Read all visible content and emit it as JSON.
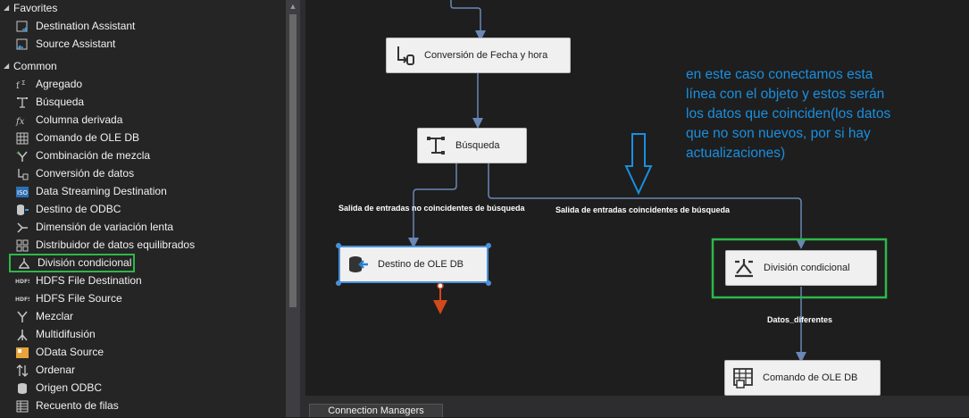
{
  "toolbox": {
    "favorites": {
      "label": "Favorites",
      "items": [
        {
          "label": "Destination Assistant",
          "icon": "destination-assistant-icon"
        },
        {
          "label": "Source Assistant",
          "icon": "source-assistant-icon"
        }
      ]
    },
    "common": {
      "label": "Common",
      "items": [
        {
          "label": "Agregado",
          "icon": "aggregate-icon"
        },
        {
          "label": "Búsqueda",
          "icon": "lookup-icon"
        },
        {
          "label": "Columna derivada",
          "icon": "derived-column-icon"
        },
        {
          "label": "Comando de OLE DB",
          "icon": "ole-db-command-icon"
        },
        {
          "label": "Combinación de mezcla",
          "icon": "merge-join-icon"
        },
        {
          "label": "Conversión de datos",
          "icon": "data-conversion-icon"
        },
        {
          "label": "Data Streaming Destination",
          "icon": "data-streaming-icon"
        },
        {
          "label": "Destino de ODBC",
          "icon": "odbc-destination-icon"
        },
        {
          "label": "Dimensión de variación lenta",
          "icon": "slowly-changing-dimension-icon"
        },
        {
          "label": "Distribuidor de datos equilibrados",
          "icon": "balanced-distributor-icon"
        },
        {
          "label": "División condicional",
          "icon": "conditional-split-icon",
          "selected": true
        },
        {
          "label": "HDFS File Destination",
          "icon": "hdfs-destination-icon"
        },
        {
          "label": "HDFS File Source",
          "icon": "hdfs-source-icon"
        },
        {
          "label": "Mezclar",
          "icon": "merge-icon"
        },
        {
          "label": "Multidifusión",
          "icon": "multicast-icon"
        },
        {
          "label": "OData Source",
          "icon": "odata-source-icon"
        },
        {
          "label": "Ordenar",
          "icon": "sort-icon"
        },
        {
          "label": "Origen ODBC",
          "icon": "odbc-source-icon"
        },
        {
          "label": "Recuento de filas",
          "icon": "row-count-icon"
        }
      ]
    }
  },
  "canvas": {
    "components": {
      "fecha": {
        "label": "Conversión de Fecha y hora",
        "icon": "derived-column-icon"
      },
      "busqueda": {
        "label": "Búsqueda",
        "icon": "lookup-icon"
      },
      "destino": {
        "label": "Destino de OLE DB",
        "icon": "ole-db-destination-icon"
      },
      "division": {
        "label": "División condicional",
        "icon": "conditional-split-icon"
      },
      "comando": {
        "label": "Comando de OLE DB",
        "icon": "ole-db-command-icon"
      }
    },
    "paths": {
      "no_match": "Salida de entradas no coincidentes de búsqueda",
      "match": "Salida de entradas coincidentes de búsqueda",
      "diferentes": "Datos_diferentes"
    },
    "annotation": "en este caso conectamos esta línea con el objeto y estos serán los datos que coinciden(los datos que no son nuevos, por si hay actualizaciones)"
  },
  "colors": {
    "annotation": "#1a8fe0",
    "highlight": "#2db84a",
    "connector": "#6a87b5",
    "error_path": "#d04a1c"
  },
  "bottom": {
    "tab_connection_managers": "Connection Managers"
  }
}
